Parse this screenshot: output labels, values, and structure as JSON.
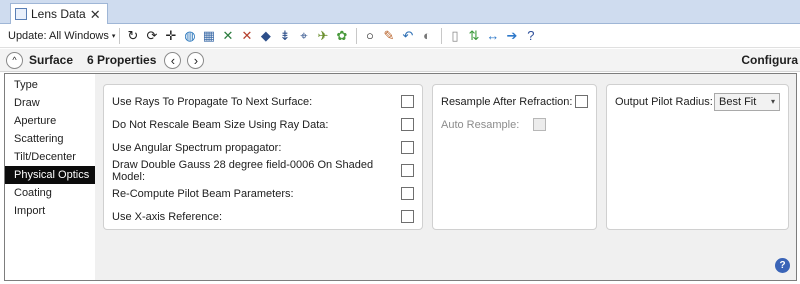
{
  "tab": {
    "title": "Lens Data",
    "close": "✕"
  },
  "toolbar": {
    "update_label": "Update: All Windows",
    "update_caret": "▾",
    "icons": [
      {
        "name": "update-icon",
        "glyph": "↻",
        "color": "#222222"
      },
      {
        "name": "settings-icon",
        "glyph": "⟳",
        "color": "#222222"
      },
      {
        "name": "move-icon",
        "glyph": "✛",
        "color": "#222222"
      },
      {
        "name": "globe-icon",
        "glyph": "◍",
        "color": "#1f6fb8"
      },
      {
        "name": "layout-icon",
        "glyph": "▦",
        "color": "#3d6ca8"
      },
      {
        "name": "slider-cross-icon",
        "glyph": "✕",
        "color": "#2a7b3d"
      },
      {
        "name": "slider-cross-red-icon",
        "glyph": "✕",
        "color": "#b5402e"
      },
      {
        "name": "lens-icon",
        "glyph": "◆",
        "color": "#2d4f8a"
      },
      {
        "name": "ray-icon",
        "glyph": "⇟",
        "color": "#2d4f8a"
      },
      {
        "name": "bracket-icon",
        "glyph": "⌖",
        "color": "#2d4f8a"
      },
      {
        "name": "fly-icon",
        "glyph": "✈",
        "color": "#6b8f2e"
      },
      {
        "name": "palette-icon",
        "glyph": "✿",
        "color": "#4a9a3d"
      },
      {
        "name": "circle-icon",
        "glyph": "○",
        "color": "#111111"
      },
      {
        "name": "brush-icon",
        "glyph": "✎",
        "color": "#b55a1e"
      },
      {
        "name": "undo-icon",
        "glyph": "↶",
        "color": "#2d6fb5"
      },
      {
        "name": "toggle-icon",
        "glyph": "◐",
        "color": "#777777"
      },
      {
        "name": "page-icon",
        "glyph": "▯",
        "color": "#888888"
      },
      {
        "name": "swap-icon",
        "glyph": "⇅",
        "color": "#3a9a3a"
      },
      {
        "name": "expand-icon",
        "glyph": "↔",
        "color": "#2d78c9"
      },
      {
        "name": "arrow-right-icon",
        "glyph": "➔",
        "color": "#2d78c9"
      },
      {
        "name": "help-icon",
        "glyph": "?",
        "color": "#2d4f9a"
      }
    ]
  },
  "surface_bar": {
    "up": "^",
    "surface_label": "Surface",
    "properties_label": "6 Properties",
    "prev": "‹",
    "next": "›",
    "configuration_label": "Configura"
  },
  "sidebar": {
    "items": [
      {
        "label": "Type",
        "active": false
      },
      {
        "label": "Draw",
        "active": false
      },
      {
        "label": "Aperture",
        "active": false
      },
      {
        "label": "Scattering",
        "active": false
      },
      {
        "label": "Tilt/Decenter",
        "active": false
      },
      {
        "label": "Physical Optics",
        "active": true
      },
      {
        "label": "Coating",
        "active": false
      },
      {
        "label": "Import",
        "active": false
      }
    ]
  },
  "group1": {
    "rows": [
      {
        "label": "Use Rays To Propagate To Next Surface:",
        "checked": false
      },
      {
        "label": "Do Not Rescale Beam Size Using Ray Data:",
        "checked": false
      },
      {
        "label": "Use Angular Spectrum propagator:",
        "checked": false
      },
      {
        "label": "Draw Double Gauss 28 degree field-0006 On Shaded Model:",
        "checked": false
      },
      {
        "label": "Re-Compute Pilot Beam Parameters:",
        "checked": false
      },
      {
        "label": "Use X-axis Reference:",
        "checked": false
      }
    ]
  },
  "group2": {
    "resample_label": "Resample After Refraction:",
    "resample_checked": false,
    "auto_resample_label": "Auto Resample:",
    "auto_resample_checked": false
  },
  "group3": {
    "output_label": "Output Pilot Radius:",
    "output_value": "Best Fit",
    "output_caret": "▾"
  },
  "help": "?"
}
